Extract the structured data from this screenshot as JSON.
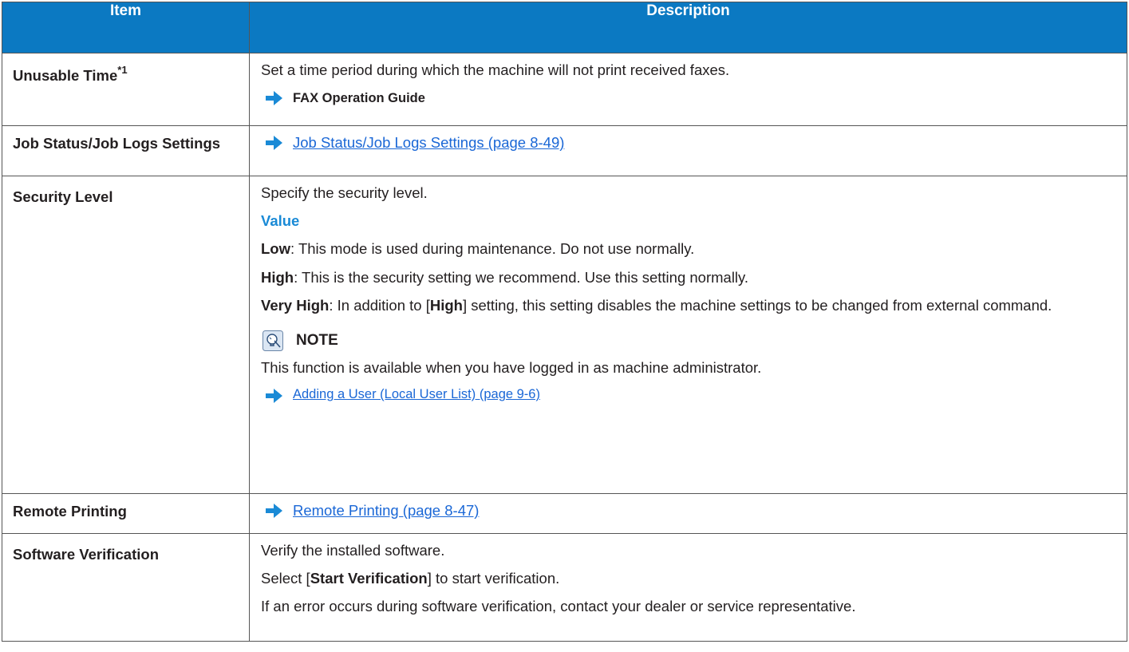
{
  "header": {
    "item": "Item",
    "description": "Description"
  },
  "colors": {
    "header_bg": "#0b79c2",
    "link": "#1a67d6",
    "value_heading": "#1a8ad6",
    "arrow": "#1a8ad6"
  },
  "rows": {
    "unusable_time": {
      "item": "Unusable Time",
      "footnote": "*1",
      "text": "Set a time period during which the machine will not print received faxes.",
      "ref": "FAX Operation Guide"
    },
    "job_status": {
      "item": "Job Status/Job Logs Settings",
      "link": "Job Status/Job Logs Settings (page 8-49)"
    },
    "security_level": {
      "item": "Security Level",
      "text": "Specify the security level.",
      "value_heading": "Value",
      "low_label": "Low",
      "low_text": ": This mode is used during maintenance. Do not use normally.",
      "high_label": "High",
      "high_text": ": This is the security setting we recommend. Use this setting normally.",
      "very_high_label": "Very High",
      "very_high_text_a": ": In addition to [",
      "very_high_text_b": "High",
      "very_high_text_c": "] setting, this setting disables the machine settings to be changed from external command.",
      "note_heading": "NOTE",
      "note_text": "This function is available when you have logged in as machine administrator.",
      "note_link": "Adding a User (Local User List) (page 9-6)"
    },
    "remote_printing": {
      "item": "Remote Printing",
      "link": "Remote Printing (page 8-47)"
    },
    "software_verification": {
      "item": "Software Verification",
      "text1": "Verify the installed software.",
      "text2_a": "Select [",
      "text2_b": "Start Verification",
      "text2_c": "] to start verification.",
      "text3": "If an error occurs during software verification, contact your dealer or service representative."
    }
  }
}
